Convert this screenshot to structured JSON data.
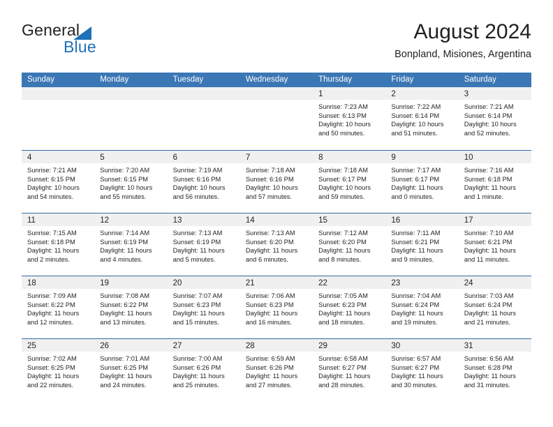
{
  "brand": {
    "name_part1": "General",
    "name_part2": "Blue",
    "triangle_color": "#1f71b8"
  },
  "header": {
    "title": "August 2024",
    "subtitle": "Bonpland, Misiones, Argentina"
  },
  "theme": {
    "header_blue": "#3b77b5",
    "separator_blue": "#2e6da4",
    "daynum_band": "#f0f0f0",
    "text": "#231f20"
  },
  "weekdays": [
    "Sunday",
    "Monday",
    "Tuesday",
    "Wednesday",
    "Thursday",
    "Friday",
    "Saturday"
  ],
  "weeks": [
    [
      {
        "day": "",
        "lines": []
      },
      {
        "day": "",
        "lines": []
      },
      {
        "day": "",
        "lines": []
      },
      {
        "day": "",
        "lines": []
      },
      {
        "day": "1",
        "lines": [
          "Sunrise: 7:23 AM",
          "Sunset: 6:13 PM",
          "Daylight: 10 hours",
          "and 50 minutes."
        ]
      },
      {
        "day": "2",
        "lines": [
          "Sunrise: 7:22 AM",
          "Sunset: 6:14 PM",
          "Daylight: 10 hours",
          "and 51 minutes."
        ]
      },
      {
        "day": "3",
        "lines": [
          "Sunrise: 7:21 AM",
          "Sunset: 6:14 PM",
          "Daylight: 10 hours",
          "and 52 minutes."
        ]
      }
    ],
    [
      {
        "day": "4",
        "lines": [
          "Sunrise: 7:21 AM",
          "Sunset: 6:15 PM",
          "Daylight: 10 hours",
          "and 54 minutes."
        ]
      },
      {
        "day": "5",
        "lines": [
          "Sunrise: 7:20 AM",
          "Sunset: 6:15 PM",
          "Daylight: 10 hours",
          "and 55 minutes."
        ]
      },
      {
        "day": "6",
        "lines": [
          "Sunrise: 7:19 AM",
          "Sunset: 6:16 PM",
          "Daylight: 10 hours",
          "and 56 minutes."
        ]
      },
      {
        "day": "7",
        "lines": [
          "Sunrise: 7:18 AM",
          "Sunset: 6:16 PM",
          "Daylight: 10 hours",
          "and 57 minutes."
        ]
      },
      {
        "day": "8",
        "lines": [
          "Sunrise: 7:18 AM",
          "Sunset: 6:17 PM",
          "Daylight: 10 hours",
          "and 59 minutes."
        ]
      },
      {
        "day": "9",
        "lines": [
          "Sunrise: 7:17 AM",
          "Sunset: 6:17 PM",
          "Daylight: 11 hours",
          "and 0 minutes."
        ]
      },
      {
        "day": "10",
        "lines": [
          "Sunrise: 7:16 AM",
          "Sunset: 6:18 PM",
          "Daylight: 11 hours",
          "and 1 minute."
        ]
      }
    ],
    [
      {
        "day": "11",
        "lines": [
          "Sunrise: 7:15 AM",
          "Sunset: 6:18 PM",
          "Daylight: 11 hours",
          "and 2 minutes."
        ]
      },
      {
        "day": "12",
        "lines": [
          "Sunrise: 7:14 AM",
          "Sunset: 6:19 PM",
          "Daylight: 11 hours",
          "and 4 minutes."
        ]
      },
      {
        "day": "13",
        "lines": [
          "Sunrise: 7:13 AM",
          "Sunset: 6:19 PM",
          "Daylight: 11 hours",
          "and 5 minutes."
        ]
      },
      {
        "day": "14",
        "lines": [
          "Sunrise: 7:13 AM",
          "Sunset: 6:20 PM",
          "Daylight: 11 hours",
          "and 6 minutes."
        ]
      },
      {
        "day": "15",
        "lines": [
          "Sunrise: 7:12 AM",
          "Sunset: 6:20 PM",
          "Daylight: 11 hours",
          "and 8 minutes."
        ]
      },
      {
        "day": "16",
        "lines": [
          "Sunrise: 7:11 AM",
          "Sunset: 6:21 PM",
          "Daylight: 11 hours",
          "and 9 minutes."
        ]
      },
      {
        "day": "17",
        "lines": [
          "Sunrise: 7:10 AM",
          "Sunset: 6:21 PM",
          "Daylight: 11 hours",
          "and 11 minutes."
        ]
      }
    ],
    [
      {
        "day": "18",
        "lines": [
          "Sunrise: 7:09 AM",
          "Sunset: 6:22 PM",
          "Daylight: 11 hours",
          "and 12 minutes."
        ]
      },
      {
        "day": "19",
        "lines": [
          "Sunrise: 7:08 AM",
          "Sunset: 6:22 PM",
          "Daylight: 11 hours",
          "and 13 minutes."
        ]
      },
      {
        "day": "20",
        "lines": [
          "Sunrise: 7:07 AM",
          "Sunset: 6:23 PM",
          "Daylight: 11 hours",
          "and 15 minutes."
        ]
      },
      {
        "day": "21",
        "lines": [
          "Sunrise: 7:06 AM",
          "Sunset: 6:23 PM",
          "Daylight: 11 hours",
          "and 16 minutes."
        ]
      },
      {
        "day": "22",
        "lines": [
          "Sunrise: 7:05 AM",
          "Sunset: 6:23 PM",
          "Daylight: 11 hours",
          "and 18 minutes."
        ]
      },
      {
        "day": "23",
        "lines": [
          "Sunrise: 7:04 AM",
          "Sunset: 6:24 PM",
          "Daylight: 11 hours",
          "and 19 minutes."
        ]
      },
      {
        "day": "24",
        "lines": [
          "Sunrise: 7:03 AM",
          "Sunset: 6:24 PM",
          "Daylight: 11 hours",
          "and 21 minutes."
        ]
      }
    ],
    [
      {
        "day": "25",
        "lines": [
          "Sunrise: 7:02 AM",
          "Sunset: 6:25 PM",
          "Daylight: 11 hours",
          "and 22 minutes."
        ]
      },
      {
        "day": "26",
        "lines": [
          "Sunrise: 7:01 AM",
          "Sunset: 6:25 PM",
          "Daylight: 11 hours",
          "and 24 minutes."
        ]
      },
      {
        "day": "27",
        "lines": [
          "Sunrise: 7:00 AM",
          "Sunset: 6:26 PM",
          "Daylight: 11 hours",
          "and 25 minutes."
        ]
      },
      {
        "day": "28",
        "lines": [
          "Sunrise: 6:59 AM",
          "Sunset: 6:26 PM",
          "Daylight: 11 hours",
          "and 27 minutes."
        ]
      },
      {
        "day": "29",
        "lines": [
          "Sunrise: 6:58 AM",
          "Sunset: 6:27 PM",
          "Daylight: 11 hours",
          "and 28 minutes."
        ]
      },
      {
        "day": "30",
        "lines": [
          "Sunrise: 6:57 AM",
          "Sunset: 6:27 PM",
          "Daylight: 11 hours",
          "and 30 minutes."
        ]
      },
      {
        "day": "31",
        "lines": [
          "Sunrise: 6:56 AM",
          "Sunset: 6:28 PM",
          "Daylight: 11 hours",
          "and 31 minutes."
        ]
      }
    ]
  ]
}
